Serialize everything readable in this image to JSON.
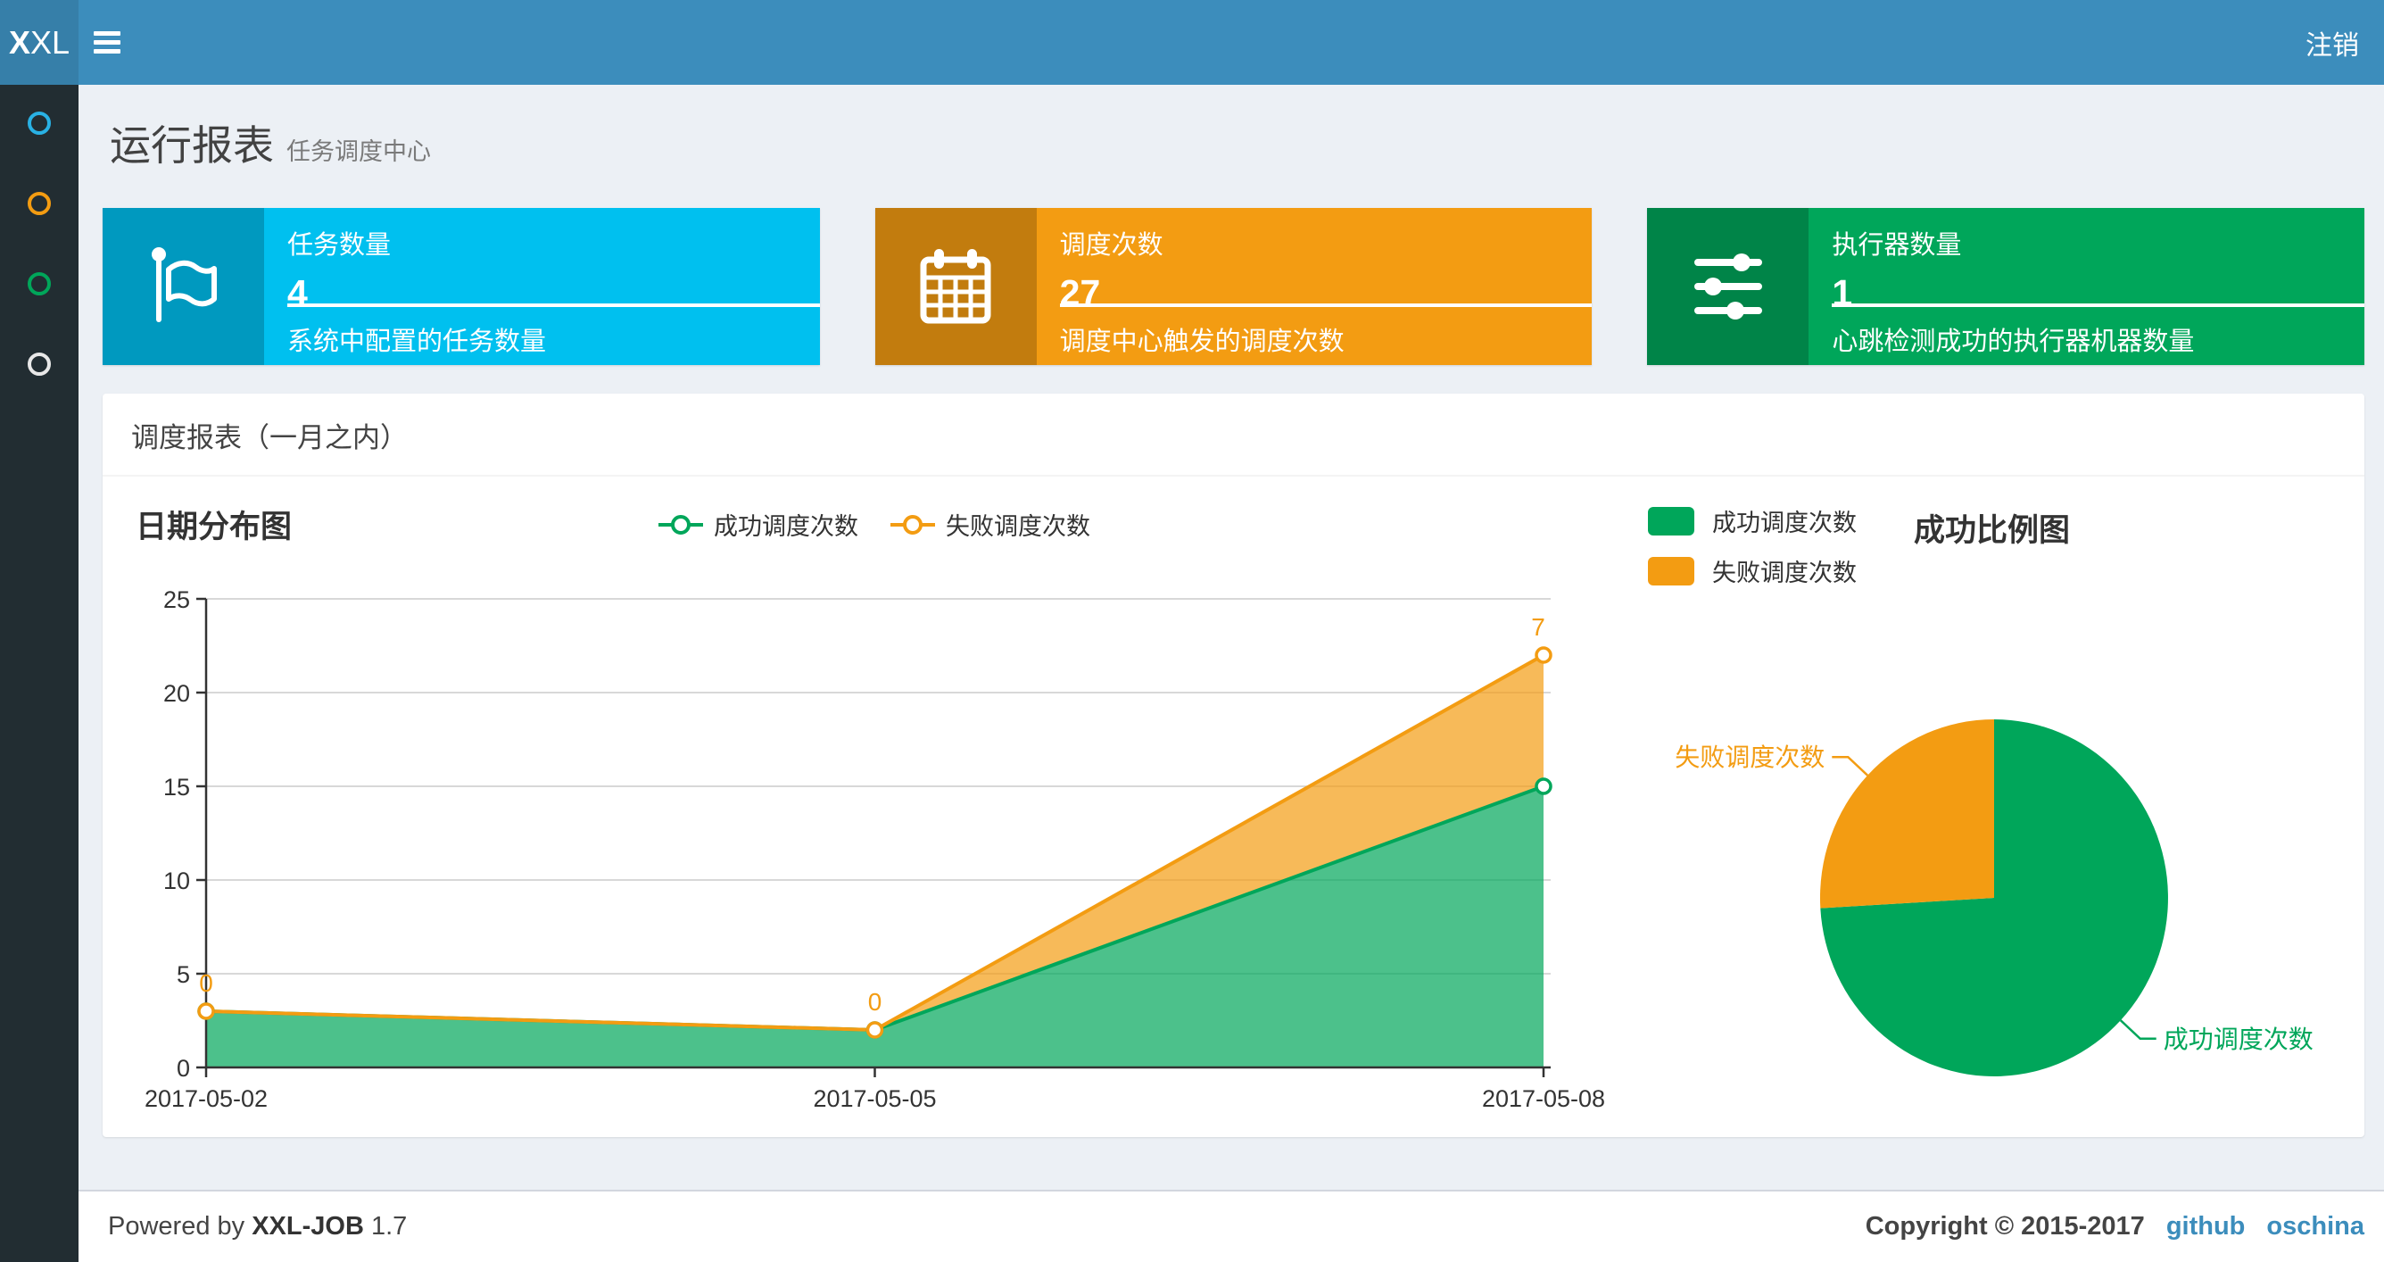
{
  "navbar": {
    "logo_bold": "X",
    "logo_rest": "XL",
    "logout_label": "注销",
    "bg_color": "#3c8dbc",
    "logo_bg_color": "#367fa9"
  },
  "sidebar": {
    "bg_color": "#222d32",
    "items": [
      {
        "icon": "circle-icon",
        "color": "#29b1e4"
      },
      {
        "icon": "circle-icon",
        "color": "#f39c12"
      },
      {
        "icon": "circle-icon",
        "color": "#00a65a"
      },
      {
        "icon": "circle-icon",
        "color": "#e8e8e8"
      }
    ]
  },
  "header": {
    "title": "运行报表",
    "subtitle": "任务调度中心"
  },
  "stat_boxes": [
    {
      "title": "任务数量",
      "value": "4",
      "description": "系统中配置的任务数量",
      "color": "#00c0ef",
      "icon": "flag-icon"
    },
    {
      "title": "调度次数",
      "value": "27",
      "description": "调度中心触发的调度次数",
      "color": "#f39c12",
      "icon": "calendar-icon"
    },
    {
      "title": "执行器数量",
      "value": "1",
      "description": "心跳检测成功的执行器机器数量",
      "color": "#00a65a",
      "icon": "sliders-icon"
    }
  ],
  "panel": {
    "title": "调度报表（一月之内）"
  },
  "chart_data": [
    {
      "type": "area",
      "title": "日期分布图",
      "stacked": true,
      "categories": [
        "2017-05-02",
        "2017-05-05",
        "2017-05-08"
      ],
      "series": [
        {
          "name": "成功调度次数",
          "color": "#00a65a",
          "values": [
            3,
            2,
            15
          ]
        },
        {
          "name": "失败调度次数",
          "color": "#f39c12",
          "values": [
            0,
            0,
            7
          ],
          "value_labels": [
            "0",
            "0",
            "7"
          ]
        }
      ],
      "ylim": [
        0,
        25
      ],
      "ytick_step": 5,
      "yticks": [
        0,
        5,
        10,
        15,
        20,
        25
      ],
      "grid": true,
      "legend_position": "top-center",
      "xlabel": "",
      "ylabel": ""
    },
    {
      "type": "pie",
      "title": "成功比例图",
      "slices": [
        {
          "label": "成功调度次数",
          "value": 20,
          "color": "#00a65a"
        },
        {
          "label": "失败调度次数",
          "value": 7,
          "color": "#f39c12"
        }
      ],
      "legend_position": "top-left"
    }
  ],
  "footer": {
    "powered_by": "Powered by",
    "product": "XXL-JOB",
    "version": "1.7",
    "copyright": "Copyright © 2015-2017",
    "links": [
      {
        "label": "github"
      },
      {
        "label": "oschina"
      }
    ],
    "link_color": "#3c8dbc"
  }
}
